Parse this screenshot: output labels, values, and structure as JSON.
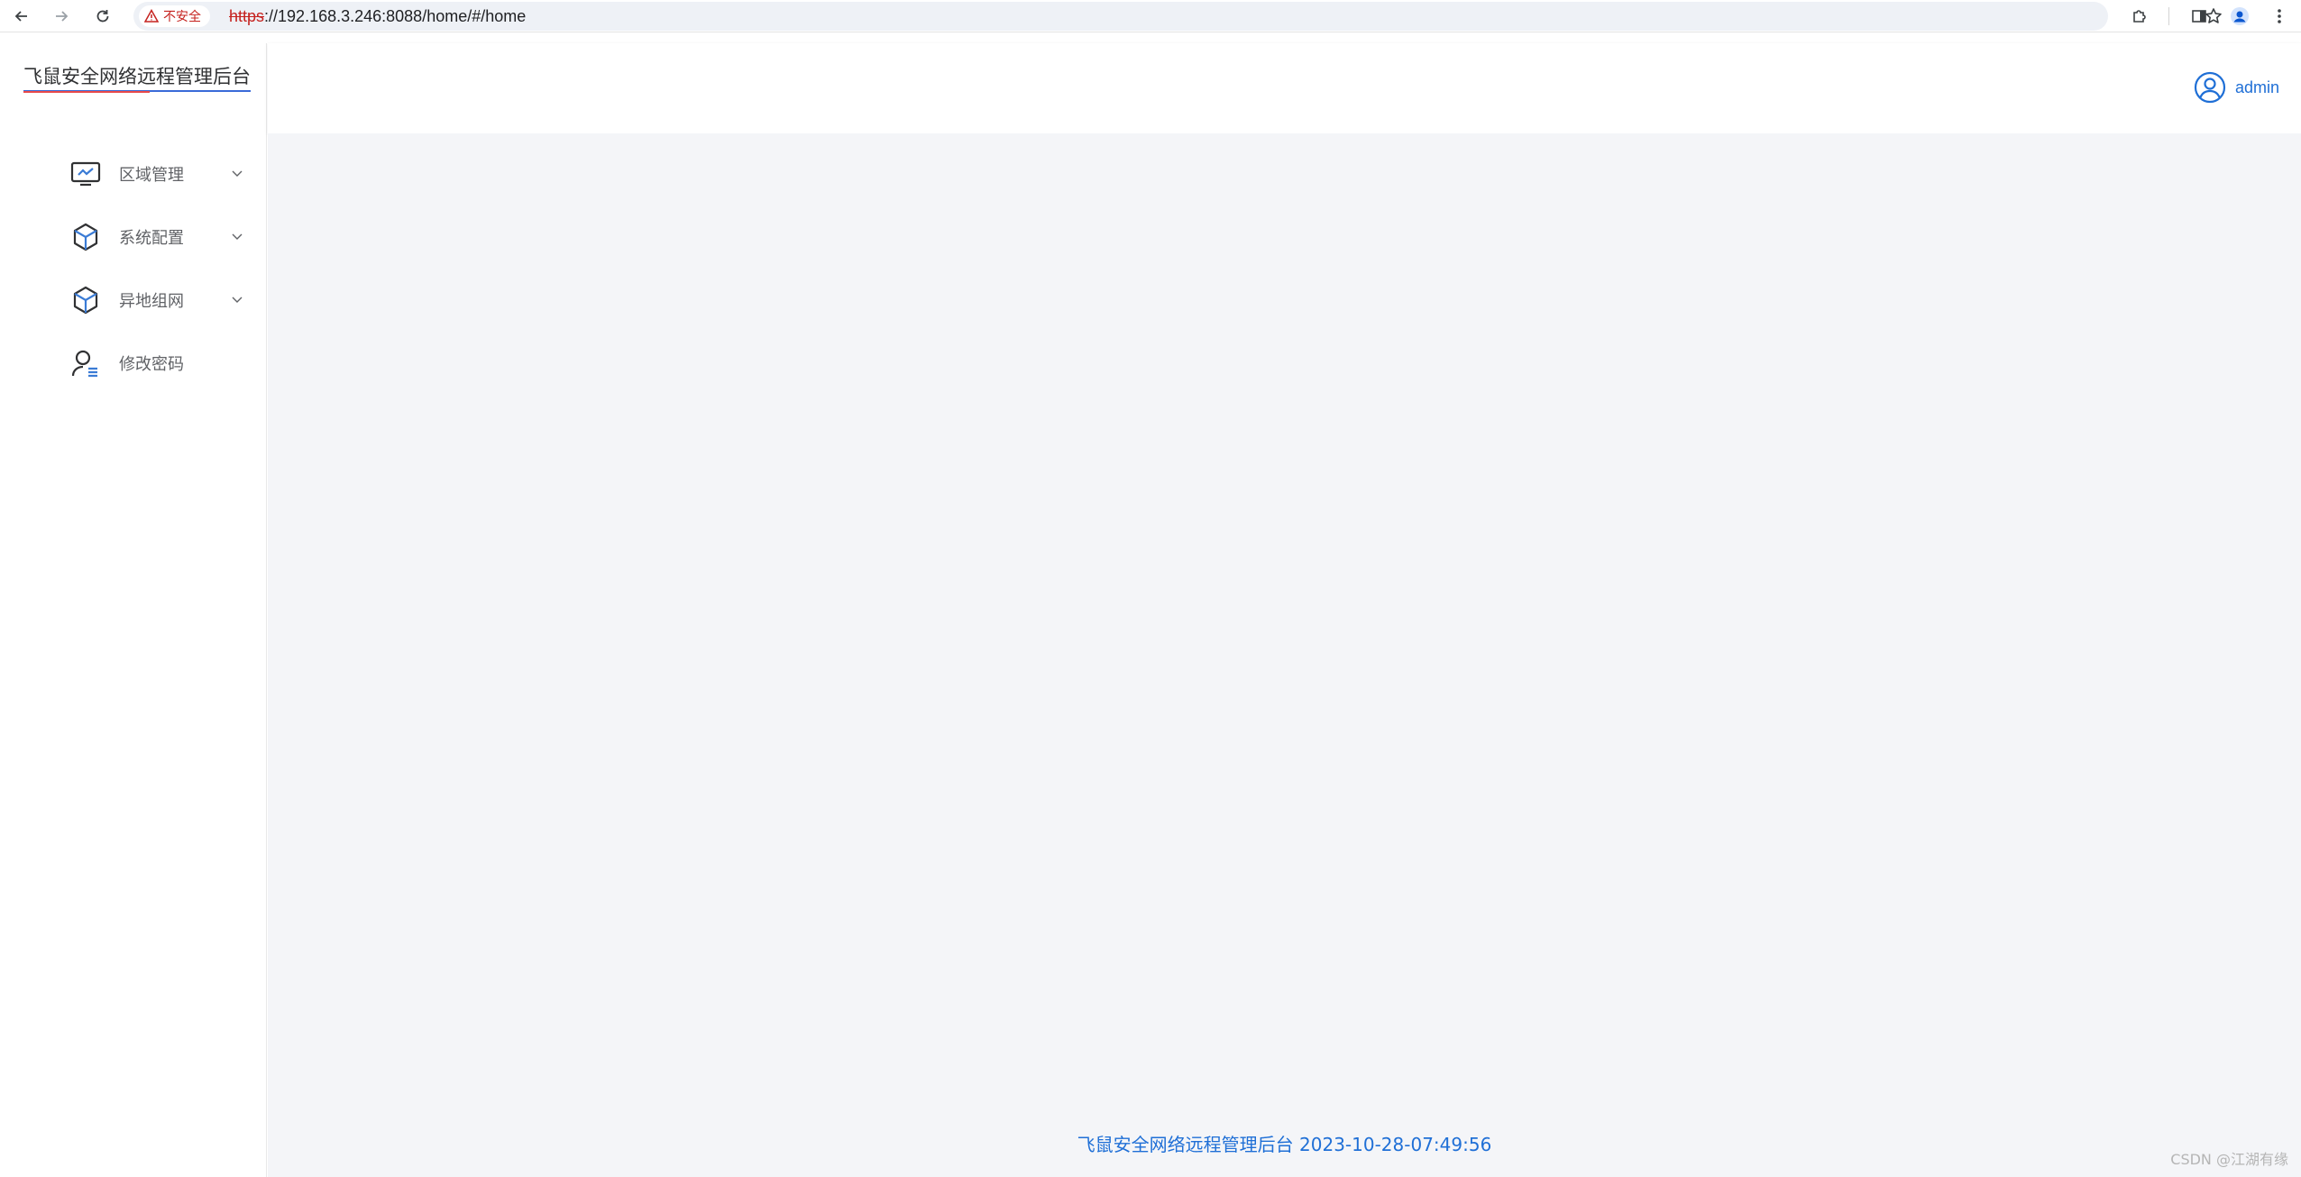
{
  "browser": {
    "insecure_label": "不安全",
    "url_scheme": "https",
    "url_rest": "://192.168.3.246:8088/home/#/home"
  },
  "sidebar": {
    "title": "飞鼠安全网络远程管理后台",
    "items": [
      {
        "label": "区域管理",
        "icon": "monitor-chart-icon",
        "has_submenu": true
      },
      {
        "label": "系统配置",
        "icon": "cube-icon",
        "has_submenu": true
      },
      {
        "label": "异地组网",
        "icon": "cube-icon",
        "has_submenu": true
      },
      {
        "label": "修改密码",
        "icon": "user-list-icon",
        "has_submenu": false
      }
    ]
  },
  "header": {
    "username": "admin",
    "avatar_icon": "user-circle-icon"
  },
  "footer": {
    "text": "飞鼠安全网络远程管理后台 2023-10-28-07:49:56"
  },
  "watermark": "CSDN @江湖有缘",
  "colors": {
    "accent": "#1f6fd6",
    "insecure": "#c5221f",
    "main_bg": "#f4f5f8"
  }
}
